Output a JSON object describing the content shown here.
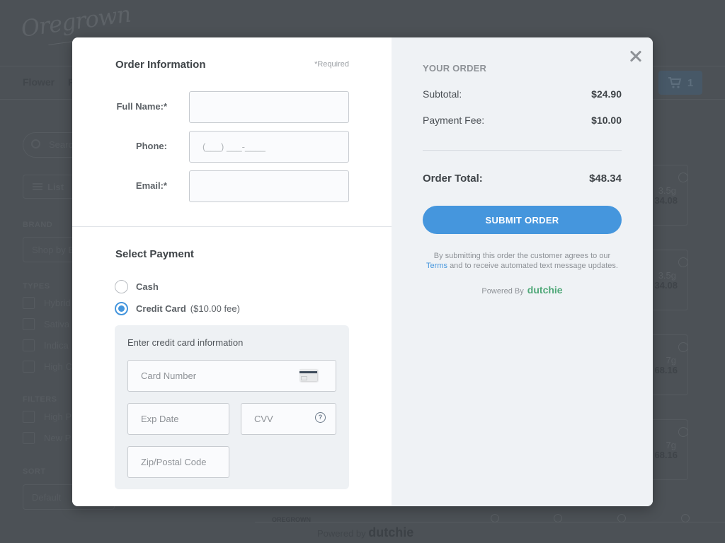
{
  "background": {
    "logo": "Oregrown",
    "nav": [
      "Flower",
      "P"
    ],
    "cart_count": "1",
    "search_placeholder": "Search",
    "view_toggle": "List",
    "brand": {
      "label": "BRAND",
      "select": "Shop by B"
    },
    "types": {
      "label": "TYPES",
      "items": [
        "Hybrid",
        "Sativa",
        "Indica",
        "High C"
      ]
    },
    "filters": {
      "label": "FILTERS",
      "items": [
        "High P",
        "New P"
      ]
    },
    "sort": {
      "label": "SORT",
      "select": "Default"
    },
    "products": [
      {
        "weight": "3.5g",
        "price": "34.08"
      },
      {
        "weight": "3.5g",
        "price": "34.08"
      },
      {
        "weight": "7g",
        "price": "68.16"
      },
      {
        "weight": "7g",
        "price": "68.16"
      }
    ],
    "footer_brand": "OREGROWN",
    "powered_by": "Powered by",
    "powered_brand": "dutchie"
  },
  "order_info": {
    "title": "Order Information",
    "required_note": "*Required",
    "fields": [
      {
        "label": "Full Name:*",
        "value": "",
        "placeholder": ""
      },
      {
        "label": "Phone:",
        "value": "",
        "placeholder": "(___) ___-____"
      },
      {
        "label": "Email:*",
        "value": "",
        "placeholder": ""
      }
    ]
  },
  "payment": {
    "title": "Select Payment",
    "options": [
      {
        "label": "Cash",
        "fee": "",
        "selected": false
      },
      {
        "label": "Credit Card",
        "fee": "($10.00 fee)",
        "selected": true
      }
    ],
    "credit_card": {
      "title": "Enter credit card information",
      "card_number_placeholder": "Card Number",
      "exp_placeholder": "Exp Date",
      "cvv_placeholder": "CVV",
      "cvv_help": "?",
      "zip_placeholder": "Zip/Postal Code"
    }
  },
  "summary": {
    "title": "YOUR ORDER",
    "subtotal_label": "Subtotal:",
    "subtotal_value": "$24.90",
    "fee_label": "Payment Fee:",
    "fee_value": "$10.00",
    "total_label": "Order Total:",
    "total_value": "$48.34",
    "submit_label": "SUBMIT ORDER",
    "legal_prefix": "By submitting this order the customer agrees to our",
    "legal_link": "Terms",
    "legal_suffix": "and to receive automated text message updates.",
    "powered_by": "Powered By",
    "powered_brand": "dutchie"
  },
  "colors": {
    "accent": "#4596dd",
    "brand_green": "#4fa878",
    "overlay": "#4c5156",
    "panel": "#eff2f5"
  }
}
